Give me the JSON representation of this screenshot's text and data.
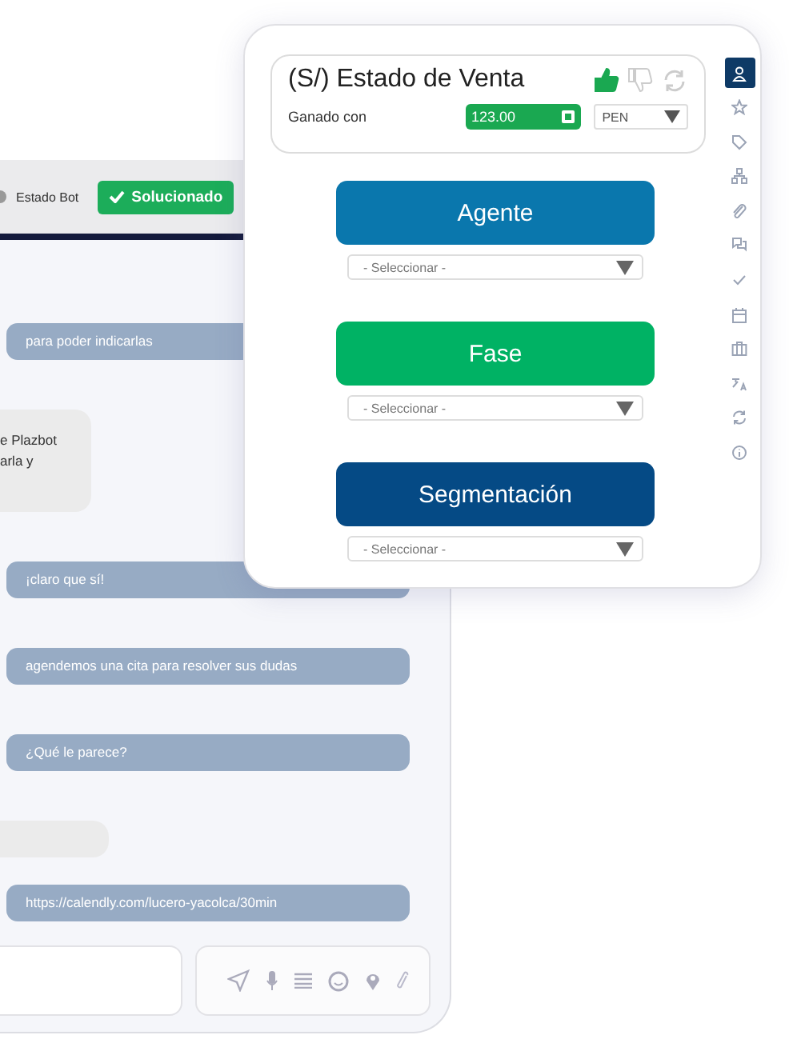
{
  "chat": {
    "header": {
      "label": "Estado Bot",
      "status_button": "Solucionado"
    },
    "messages": [
      {
        "kind": "outgoing",
        "text": "para poder indicarlas"
      },
      {
        "kind": "incoming",
        "lines": [
          "e Plazbot",
          "arla y"
        ]
      },
      {
        "kind": "outgoing",
        "text": "¡claro que sí!"
      },
      {
        "kind": "outgoing",
        "text": "agendemos una cita para resolver sus dudas"
      },
      {
        "kind": "outgoing",
        "text": "¿Qué le parece?"
      },
      {
        "kind": "incoming"
      },
      {
        "kind": "outgoing",
        "text": "https://calendly.com/lucero-yacolca/30min"
      }
    ]
  },
  "sales_panel": {
    "title": "(S/) Estado de Venta",
    "votes": [
      {
        "kind": "up",
        "selected": true
      },
      {
        "kind": "down",
        "selected": false
      }
    ],
    "amount": {
      "label": "Ganado con",
      "value": "123.00"
    },
    "currency": {
      "value": "PEN"
    },
    "actions": [
      {
        "label": "Agente",
        "color": "#0a77ad",
        "select_value": "- Seleccionar -"
      },
      {
        "label": "Fase",
        "color": "#00b264",
        "select_value": "- Seleccionar -"
      },
      {
        "label": "Segmentación",
        "color": "#054a85",
        "select_value": "- Seleccionar -"
      }
    ]
  },
  "sidebar": [
    {
      "kind": "user",
      "selected": true
    },
    {
      "kind": "star",
      "selected": false
    },
    {
      "kind": "tag",
      "selected": false
    },
    {
      "kind": "sitemap",
      "selected": false
    },
    {
      "kind": "clip",
      "selected": false
    },
    {
      "kind": "chat",
      "selected": false
    },
    {
      "kind": "check",
      "selected": false
    },
    {
      "kind": "calendar",
      "selected": false
    },
    {
      "kind": "briefcase",
      "selected": false
    },
    {
      "kind": "translate",
      "selected": false
    },
    {
      "kind": "sync",
      "selected": false
    },
    {
      "kind": "info",
      "selected": false
    }
  ]
}
